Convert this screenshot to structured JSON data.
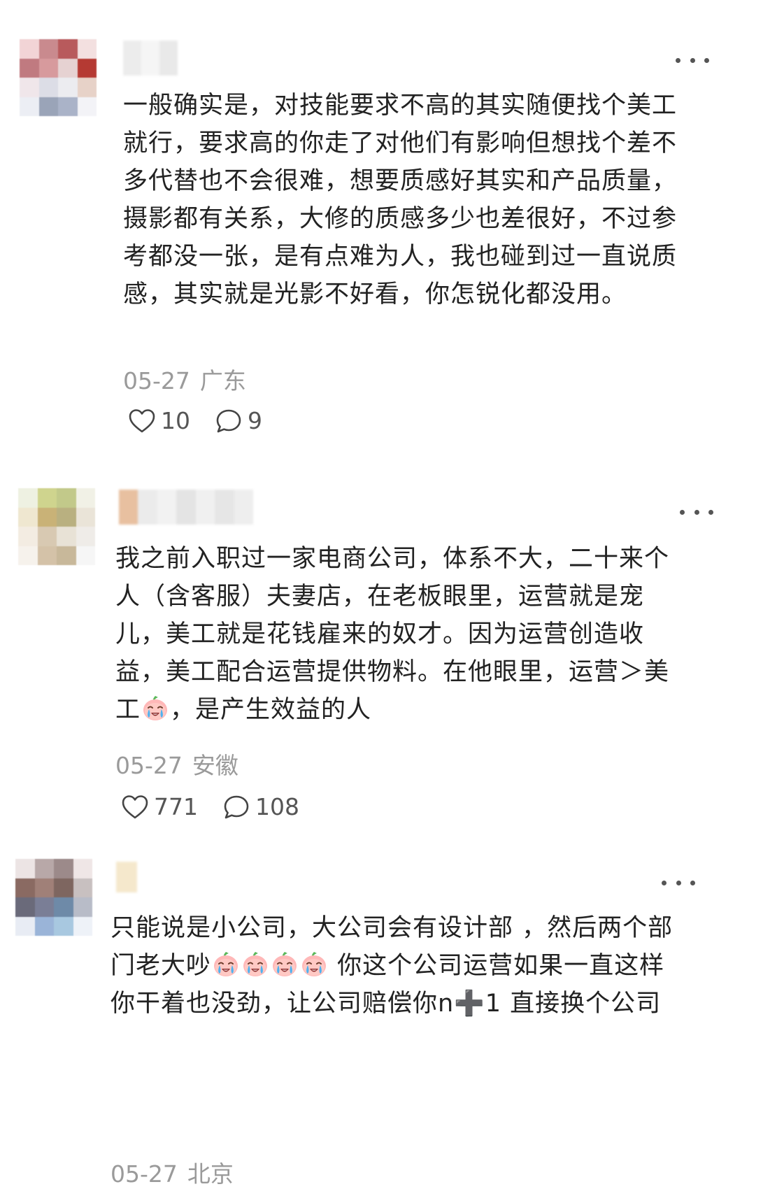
{
  "comments": [
    {
      "avatar_colors": [
        "#f2d4d6",
        "#c98a8e",
        "#b85a5c",
        "#f3e0e0",
        "#c07a80",
        "#d79a9d",
        "#e6d2d2",
        "#b53a33",
        "#f0e6ea",
        "#dcdde6",
        "#ececf0",
        "#e7d2c8",
        "#eceef4",
        "#9aa4b8",
        "#aab3c8",
        "#f3f3f7"
      ],
      "name_colors": [
        "#ececec",
        "#f5f5f5",
        "#e9e9e9"
      ],
      "body_segments": [
        {
          "t": "一般确实是，对技能要求不高的其实随便找个美工就行，要求高的你走了对他们有影响但想找个差不多代替也不会很难，想要质感好其实和产品质量，摄影都有关系，大修的质感多少也差很好，不过参考都没一张，是有点难为人，我也碰到过一直说质感，其实就是光影不好看，你怎锐化都没用。"
        }
      ],
      "date": "05-27",
      "region": "广东",
      "likes": "10",
      "replies": "9"
    },
    {
      "avatar_colors": [
        "#eef1e2",
        "#cfd48e",
        "#c2c98a",
        "#f1f1e6",
        "#efe7d0",
        "#c9b277",
        "#b9b080",
        "#eae4d8",
        "#f3ece2",
        "#d8c9b2",
        "#e8e2d6",
        "#efece8",
        "#f6f2ec",
        "#d4c2a8",
        "#c8b89a",
        "#f6f6f6"
      ],
      "name_colors": [
        "#e8c0a0",
        "#ebebeb",
        "#f2f2f2",
        "#e4e4e4",
        "#f0f0f0",
        "#e6e6e6",
        "#eeeeee"
      ],
      "body_segments": [
        {
          "t": "我之前入职过一家电商公司，体系不大，二十来个人（含客服）夫妻店，在老板眼里，运营就是宠儿，美工就是花钱雇来的奴才。因为运营创造收益，美工配合运营提供物料。在他眼里，运营＞美工"
        },
        {
          "emoji": "crying-face-emoji"
        },
        {
          "t": "，是产生效益的人"
        }
      ],
      "date": "05-27",
      "region": "安徽",
      "likes": "771",
      "replies": "108"
    },
    {
      "avatar_colors": [
        "#ece4e4",
        "#b8a8a8",
        "#9c8a8a",
        "#efe6e6",
        "#8a6a62",
        "#a08078",
        "#7e6660",
        "#c8c0c0",
        "#6a6a7a",
        "#7a7e96",
        "#6e8aa8",
        "#b8bcc8",
        "#e8ecf4",
        "#9ab4d8",
        "#a8c8e0",
        "#eef2f8"
      ],
      "name_colors": [
        "#f5e8cc"
      ],
      "body_segments": [
        {
          "t": "只能说是小公司，大公司会有设计部 ，然后两个部门老大吵"
        },
        {
          "emoji": "crying-face-emoji"
        },
        {
          "emoji": "crying-face-emoji"
        },
        {
          "emoji": "crying-face-emoji"
        },
        {
          "emoji": "crying-face-emoji"
        },
        {
          "t": " 你这个公司运营如果一直这样你干着也没劲，让公司赔偿你n➕1 直接换个公司"
        }
      ],
      "date": "05-27",
      "region": "北京",
      "likes": "",
      "replies": ""
    }
  ],
  "icons": {
    "like": "heart-icon",
    "reply": "comment-bubble-icon",
    "more": "more-dots-icon"
  }
}
